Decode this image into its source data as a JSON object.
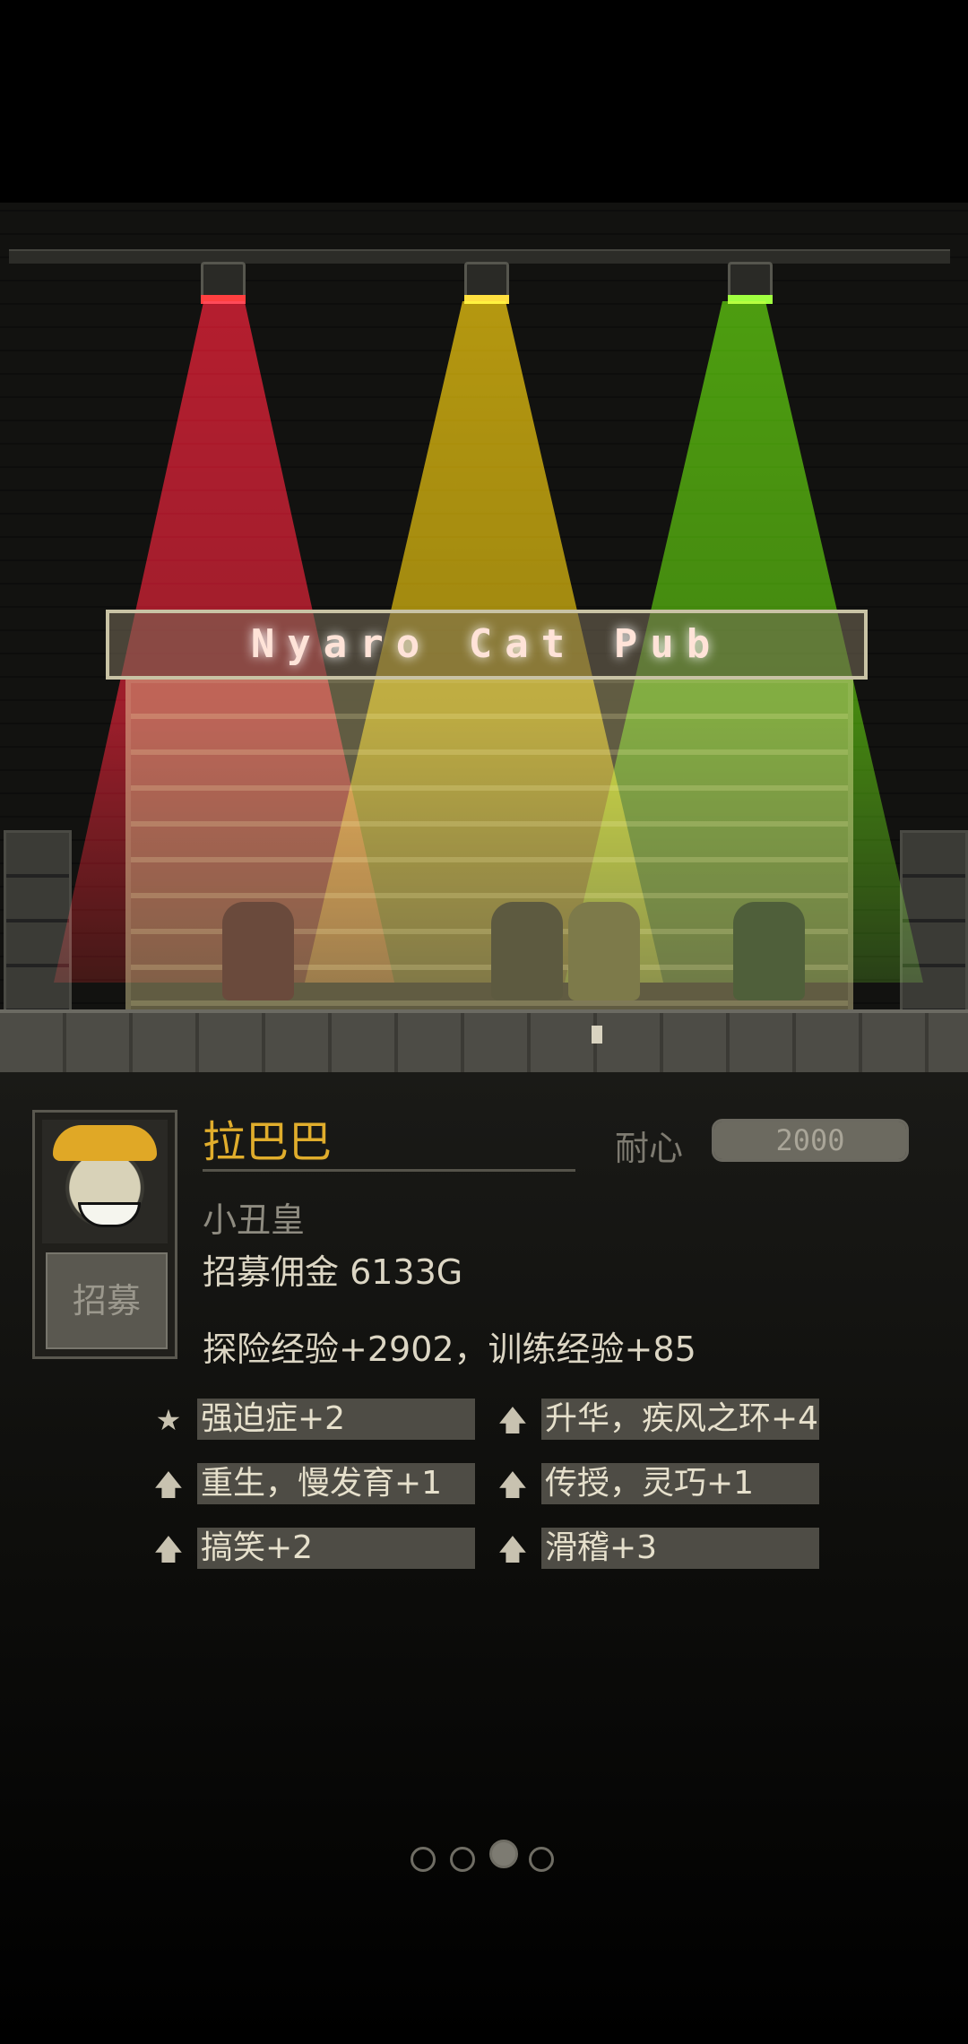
{
  "scene": {
    "sign_text": "Nyaro Cat Pub",
    "lights": [
      {
        "name": "red-spotlight",
        "color": "#ff3030"
      },
      {
        "name": "yellow-spotlight",
        "color": "#ffd400"
      },
      {
        "name": "green-spotlight",
        "color": "#7de000"
      }
    ]
  },
  "character": {
    "name": "拉巴巴",
    "title": "小丑皇",
    "recruit_button": "招募",
    "patience_label": "耐心",
    "patience_value": "2000",
    "patience_fill_fraction": 1.0,
    "recruit_fee": "招募佣金 6133G",
    "experience": "探险经验+2902，训练经验+85"
  },
  "traits": [
    {
      "icon": "star-icon",
      "glyph": "★",
      "label": "强迫症+2"
    },
    {
      "icon": "arrow-up-icon",
      "glyph": "🡅",
      "label": "升华，疾风之环+4"
    },
    {
      "icon": "arrow-up-icon",
      "glyph": "🡅",
      "label": "重生，慢发育+1"
    },
    {
      "icon": "arrow-up-icon",
      "glyph": "🡅",
      "label": "传授，灵巧+1"
    },
    {
      "icon": "arrow-up-icon",
      "glyph": "🡅",
      "label": "搞笑+2"
    },
    {
      "icon": "arrow-up-icon",
      "glyph": "🡅",
      "label": "滑稽+3"
    }
  ],
  "pager": {
    "count": 4,
    "active_index": 2
  }
}
